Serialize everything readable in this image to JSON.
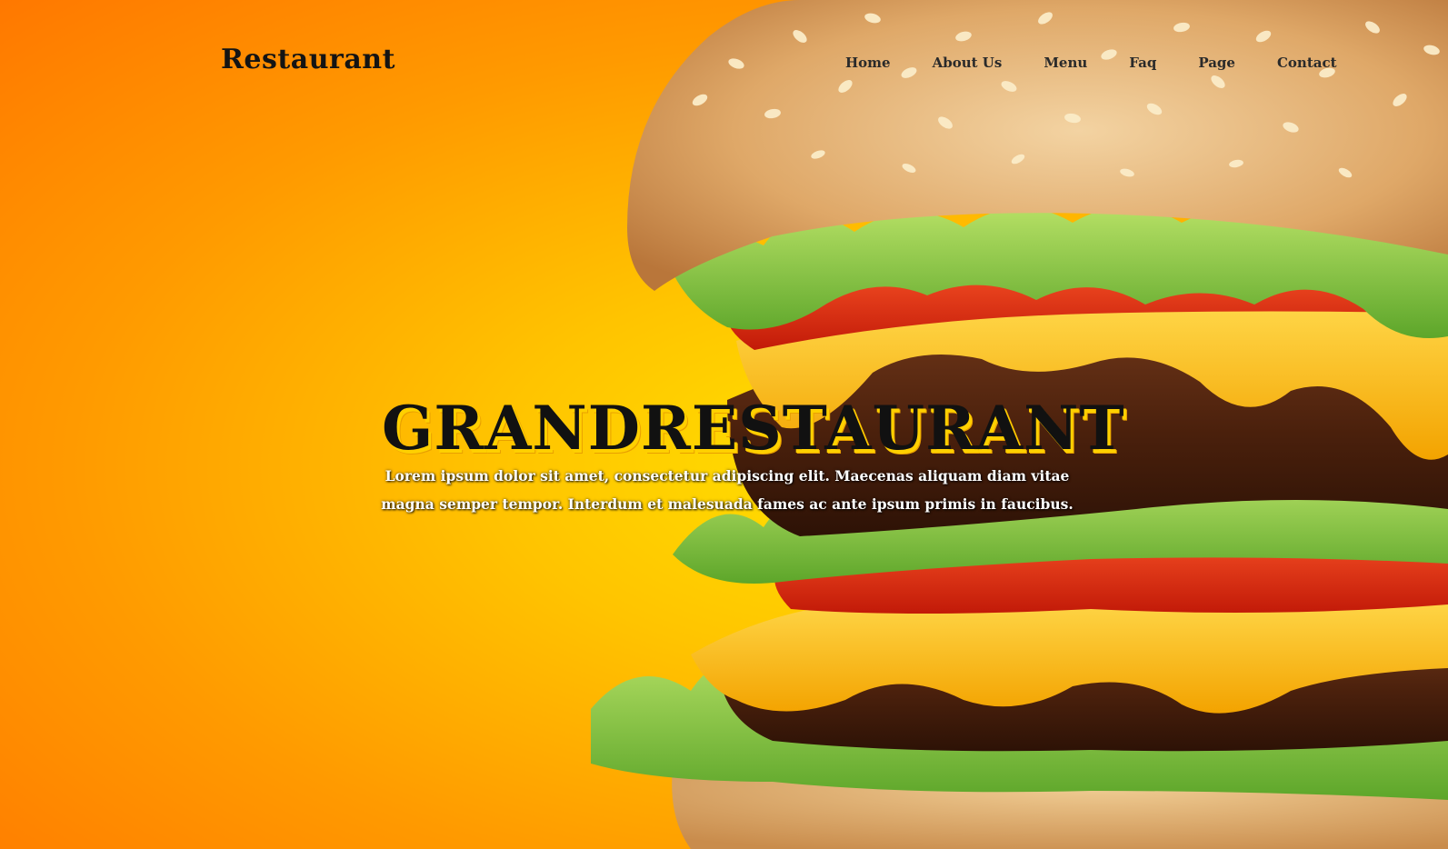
{
  "brand": {
    "logo": "Restaurant"
  },
  "nav": {
    "items": [
      "Home",
      "About Us",
      "Menu",
      "Faq",
      "Page",
      "Contact"
    ]
  },
  "hero": {
    "title": "GRANDRESTAURANT",
    "text": "Lorem ipsum dolor sit amet, consectetur adipiscing elit. Maecenas aliquam diam vitae magna semper tempor. Interdum et malesuada fames ac ante ipsum primis in faucibus.",
    "background_image": "burger-photo"
  },
  "colors": {
    "bg_orange": "#ff7800",
    "bg_yellow": "#ffd000",
    "text_dark": "#141414",
    "text_light": "#ffffff"
  }
}
